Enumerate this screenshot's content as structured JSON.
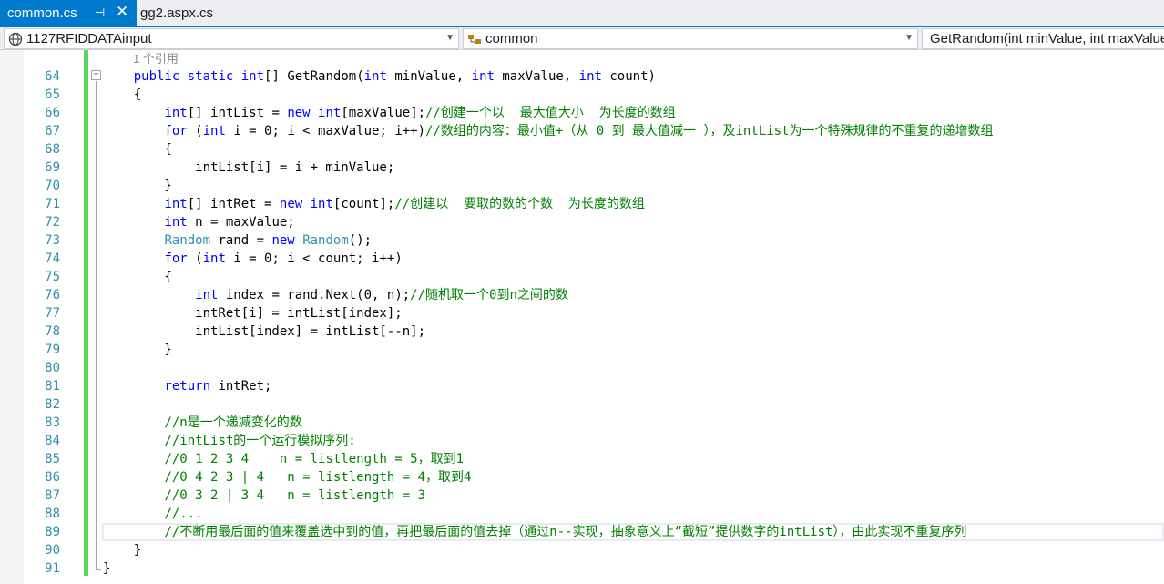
{
  "tabs": [
    {
      "label": "common.cs",
      "active": true
    },
    {
      "label": "gg2.aspx.cs",
      "active": false
    }
  ],
  "nav": {
    "project": "1127RFIDDATAinput",
    "class": "common",
    "member": "GetRandom(int minValue, int maxValue, int count)"
  },
  "editor": {
    "codelens": "1 个引用",
    "line_numbers": [
      "64",
      "65",
      "66",
      "67",
      "68",
      "69",
      "70",
      "71",
      "72",
      "73",
      "74",
      "75",
      "76",
      "77",
      "78",
      "79",
      "80",
      "81",
      "82",
      "83",
      "84",
      "85",
      "86",
      "87",
      "88",
      "89",
      "90",
      "91"
    ],
    "lines": [
      [
        {
          "t": "    "
        },
        {
          "t": "public",
          "c": "kw"
        },
        {
          "t": " "
        },
        {
          "t": "static",
          "c": "kw"
        },
        {
          "t": " "
        },
        {
          "t": "int",
          "c": "kw"
        },
        {
          "t": "[] GetRandom("
        },
        {
          "t": "int",
          "c": "kw"
        },
        {
          "t": " minValue, "
        },
        {
          "t": "int",
          "c": "kw"
        },
        {
          "t": " maxValue, "
        },
        {
          "t": "int",
          "c": "kw"
        },
        {
          "t": " count)"
        }
      ],
      [
        {
          "t": "    {"
        }
      ],
      [
        {
          "t": "        "
        },
        {
          "t": "int",
          "c": "kw"
        },
        {
          "t": "[] intList = "
        },
        {
          "t": "new",
          "c": "kw"
        },
        {
          "t": " "
        },
        {
          "t": "int",
          "c": "kw"
        },
        {
          "t": "[maxValue];"
        },
        {
          "t": "//创建一个以  最大值大小  为长度的数组",
          "c": "cm"
        }
      ],
      [
        {
          "t": "        "
        },
        {
          "t": "for",
          "c": "kw"
        },
        {
          "t": " ("
        },
        {
          "t": "int",
          "c": "kw"
        },
        {
          "t": " i = 0; i < maxValue; i++)"
        },
        {
          "t": "//数组的内容：最小值+（从 0 到 最大值减一 ），及intList为一个特殊规律的不重复的递增数组",
          "c": "cm"
        }
      ],
      [
        {
          "t": "        {"
        }
      ],
      [
        {
          "t": "            intList[i] = i + minValue;"
        }
      ],
      [
        {
          "t": "        }"
        }
      ],
      [
        {
          "t": "        "
        },
        {
          "t": "int",
          "c": "kw"
        },
        {
          "t": "[] intRet = "
        },
        {
          "t": "new",
          "c": "kw"
        },
        {
          "t": " "
        },
        {
          "t": "int",
          "c": "kw"
        },
        {
          "t": "[count];"
        },
        {
          "t": "//创建以  要取的数的个数  为长度的数组",
          "c": "cm"
        }
      ],
      [
        {
          "t": "        "
        },
        {
          "t": "int",
          "c": "kw"
        },
        {
          "t": " n = maxValue;"
        }
      ],
      [
        {
          "t": "        "
        },
        {
          "t": "Random",
          "c": "ty"
        },
        {
          "t": " rand = "
        },
        {
          "t": "new",
          "c": "kw"
        },
        {
          "t": " "
        },
        {
          "t": "Random",
          "c": "ty"
        },
        {
          "t": "();"
        }
      ],
      [
        {
          "t": "        "
        },
        {
          "t": "for",
          "c": "kw"
        },
        {
          "t": " ("
        },
        {
          "t": "int",
          "c": "kw"
        },
        {
          "t": " i = 0; i < count; i++)"
        }
      ],
      [
        {
          "t": "        {"
        }
      ],
      [
        {
          "t": "            "
        },
        {
          "t": "int",
          "c": "kw"
        },
        {
          "t": " index = rand.Next(0, n);"
        },
        {
          "t": "//随机取一个0到n之间的数",
          "c": "cm"
        }
      ],
      [
        {
          "t": "            intRet[i] = intList[index];"
        }
      ],
      [
        {
          "t": "            intList[index] = intList[--n];"
        }
      ],
      [
        {
          "t": "        }"
        }
      ],
      [
        {
          "t": ""
        }
      ],
      [
        {
          "t": "        "
        },
        {
          "t": "return",
          "c": "kw"
        },
        {
          "t": " intRet;"
        }
      ],
      [
        {
          "t": ""
        }
      ],
      [
        {
          "t": "        "
        },
        {
          "t": "//n是一个递减变化的数",
          "c": "cm"
        }
      ],
      [
        {
          "t": "        "
        },
        {
          "t": "//intList的一个运行模拟序列:",
          "c": "cm"
        }
      ],
      [
        {
          "t": "        "
        },
        {
          "t": "//0 1 2 3 4    n = listlength = 5，取到1",
          "c": "cm"
        }
      ],
      [
        {
          "t": "        "
        },
        {
          "t": "//0 4 2 3 | 4   n = listlength = 4，取到4",
          "c": "cm"
        }
      ],
      [
        {
          "t": "        "
        },
        {
          "t": "//0 3 2 | 3 4   n = listlength = 3",
          "c": "cm"
        }
      ],
      [
        {
          "t": "        "
        },
        {
          "t": "//...",
          "c": "cm"
        }
      ],
      [
        {
          "t": "        "
        },
        {
          "t": "//不断用最后面的值来覆盖选中到的值，再把最后面的值去掉（通过n--实现，抽象意义上“截短”提供数字的intList），由此实现不重复序列",
          "c": "cm"
        }
      ],
      [
        {
          "t": "    }"
        }
      ],
      [
        {
          "t": "}"
        }
      ]
    ]
  }
}
